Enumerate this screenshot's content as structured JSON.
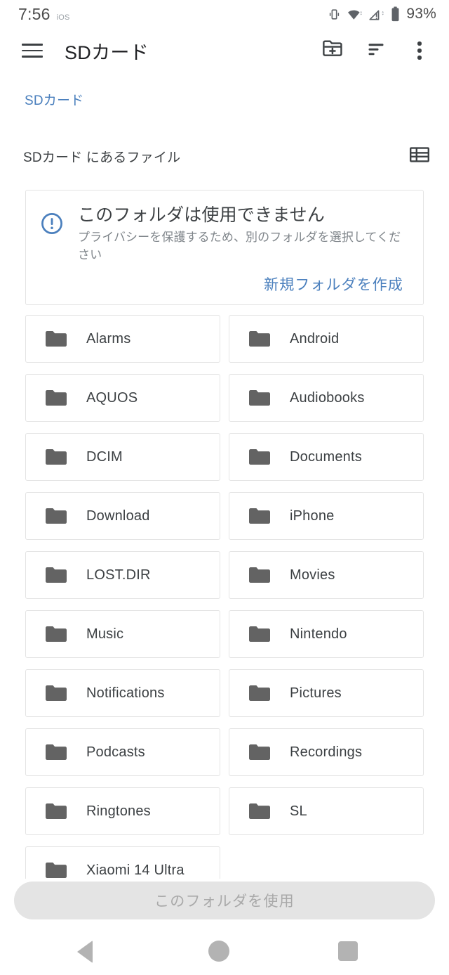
{
  "status_bar": {
    "time": "7:56",
    "carrier": "iOS",
    "battery_percent": "93%",
    "icons": [
      "vibrate-icon",
      "wifi-icon",
      "cellular-warning-icon",
      "battery-icon"
    ]
  },
  "app_bar": {
    "menu_icon": "hamburger-menu-icon",
    "title": "SDカード",
    "actions": [
      {
        "icon": "create-new-folder-icon"
      },
      {
        "icon": "sort-icon"
      },
      {
        "icon": "more-options-icon"
      }
    ]
  },
  "breadcrumb": {
    "current": "SDカード"
  },
  "section": {
    "label": "SDカード にあるファイル",
    "view_toggle_icon": "list-view-icon"
  },
  "warning_card": {
    "icon": "error-outline-icon",
    "title": "このフォルダは使用できません",
    "body": "プライバシーを保護するため、別のフォルダを選択してください",
    "action_label": "新規フォルダを作成",
    "accent_color": "#4a7fbd"
  },
  "folders": [
    {
      "name": "Alarms"
    },
    {
      "name": "Android"
    },
    {
      "name": "AQUOS"
    },
    {
      "name": "Audiobooks"
    },
    {
      "name": "DCIM"
    },
    {
      "name": "Documents"
    },
    {
      "name": "Download"
    },
    {
      "name": "iPhone"
    },
    {
      "name": "LOST.DIR"
    },
    {
      "name": "Movies"
    },
    {
      "name": "Music"
    },
    {
      "name": "Nintendo"
    },
    {
      "name": "Notifications"
    },
    {
      "name": "Pictures"
    },
    {
      "name": "Podcasts"
    },
    {
      "name": "Recordings"
    },
    {
      "name": "Ringtones"
    },
    {
      "name": "SL"
    },
    {
      "name": "Xiaomi 14 Ultra"
    }
  ],
  "bottom_bar": {
    "cta_label": "このフォルダを使用",
    "cta_enabled": false
  },
  "nav_bar": {
    "back_icon": "back-triangle-icon",
    "home_icon": "home-circle-icon",
    "recents_icon": "recents-square-icon"
  },
  "colors": {
    "accent": "#4a7fbd",
    "text_primary": "#3c4043",
    "text_secondary": "#80868b",
    "folder_icon": "#636363",
    "card_border": "#e4e4e4",
    "disabled_bg": "#e4e4e4",
    "disabled_text": "#a9a9a9"
  }
}
